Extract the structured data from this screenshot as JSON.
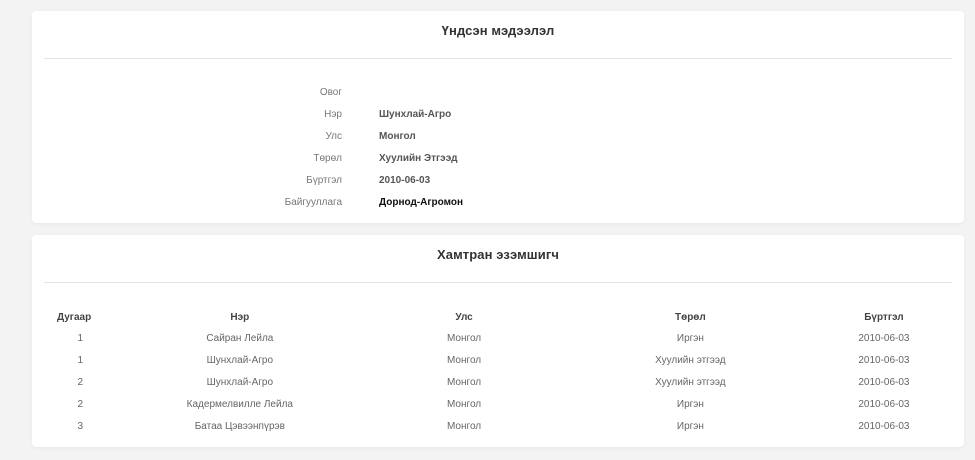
{
  "basic_info": {
    "title": "Үндсэн мэдээлэл",
    "rows": [
      {
        "label": "Овог",
        "value": ""
      },
      {
        "label": "Нэр",
        "value": "Шунхлай-Агро"
      },
      {
        "label": "Улс",
        "value": "Монгол"
      },
      {
        "label": "Төрөл",
        "value": "Хуулийн Этгээд"
      },
      {
        "label": "Бүртгэл",
        "value": "2010-06-03"
      },
      {
        "label": "Байгууллага",
        "value": "Дорнод-Агромон"
      }
    ]
  },
  "co_owner": {
    "title": "Хамтран эзэмшигч",
    "columns": [
      "Дугаар",
      "Нэр",
      "Улс",
      "Төрөл",
      "Бүртгэл"
    ],
    "rows": [
      [
        "1",
        "Сайран Лейла",
        "Монгол",
        "Иргэн",
        "2010-06-03"
      ],
      [
        "1",
        "Шунхлай-Агро",
        "Монгол",
        "Хуулийн этгээд",
        "2010-06-03"
      ],
      [
        "2",
        "Шунхлай-Агро",
        "Монгол",
        "Хуулийн этгээд",
        "2010-06-03"
      ],
      [
        "2",
        "Кадермелвилле Лейла",
        "Монгол",
        "Иргэн",
        "2010-06-03"
      ],
      [
        "3",
        "Батаа Цэвээнпүрэв",
        "Монгол",
        "Иргэн",
        "2010-06-03"
      ]
    ]
  }
}
